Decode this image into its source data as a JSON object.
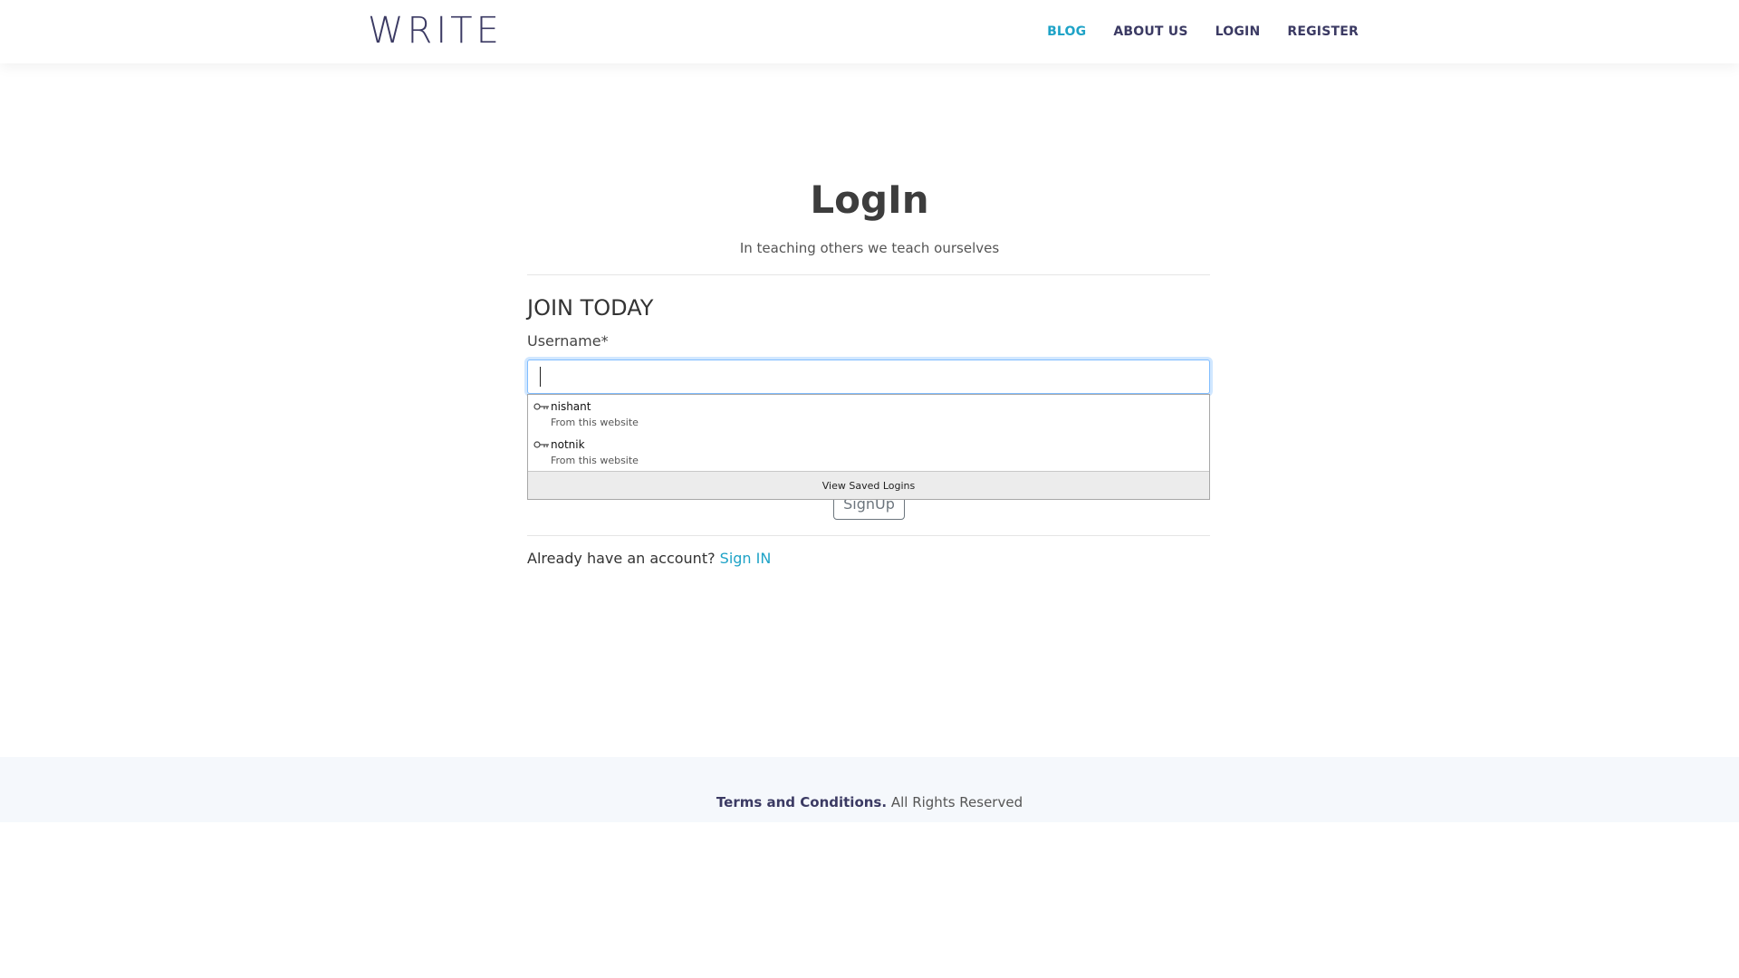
{
  "navbar": {
    "brand": "WRITE",
    "links": [
      {
        "label": "BLOG",
        "active": true
      },
      {
        "label": "ABOUT US",
        "active": false
      },
      {
        "label": "LOGIN",
        "active": false
      },
      {
        "label": "REGISTER",
        "active": false
      }
    ]
  },
  "header": {
    "title": "LogIn",
    "subtitle": "In teaching others we teach ourselves"
  },
  "form": {
    "heading": "JOIN TODAY",
    "username_label": "Username*",
    "username_value": "",
    "submit_label": "SignUp",
    "already_text": "Already have an account? ",
    "signin_label": "Sign IN"
  },
  "autocomplete": {
    "items": [
      {
        "username": "nishant",
        "source": "From this website",
        "icon": "key-icon"
      },
      {
        "username": "notnik",
        "source": "From this website",
        "icon": "key-icon"
      }
    ],
    "footer_label": "View Saved Logins"
  },
  "footer": {
    "terms_label": "Terms and Conditions.",
    "rights_text": " All Rights Reserved"
  },
  "colors": {
    "accent": "#1fa3c7",
    "brand": "#3b3a63",
    "footer_bg": "#f5f8fc"
  }
}
